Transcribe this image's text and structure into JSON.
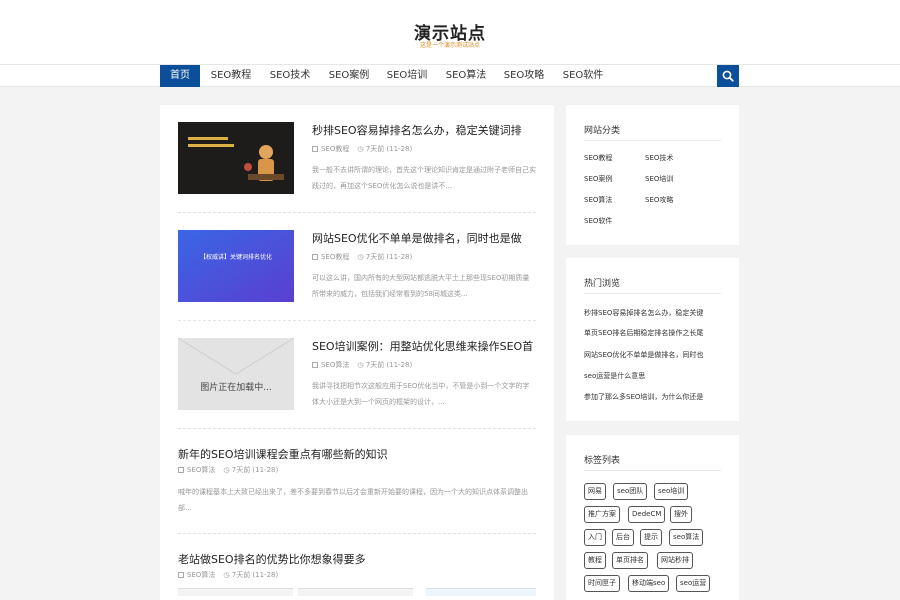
{
  "site": {
    "title": "演示站点",
    "tagline": "这是一个演示测试站点"
  },
  "nav": {
    "items": [
      "首页",
      "SEO教程",
      "SEO技术",
      "SEO案例",
      "SEO培训",
      "SEO算法",
      "SEO攻略",
      "SEO软件"
    ],
    "active_index": 0
  },
  "colors": {
    "primary": "#0b4f9b",
    "tagline": "#e08a1e"
  },
  "posts": [
    {
      "title": "秒排SEO容易掉排名怎么办，稳定关键词排",
      "category": "SEO教程",
      "time": "7天前 (11-28)",
      "excerpt": "我一般不去讲所谓的理论，首先这个理论知识肯定是通过附子老师自己实践过的，再加这个SEO优化怎么说也是讲不..."
    },
    {
      "title": "网站SEO优化不单单是做排名，同时也是做",
      "category": "SEO教程",
      "time": "7天前 (11-28)",
      "excerpt": "可以这么讲，国内所有的大型网站都逃脱大平土上那些现SEO初期质量所带来的威力，包括我们经常看到的58同城这类...",
      "thumb_text": "【权威讲】关键词排名优化"
    },
    {
      "title": "SEO培训案例：用整站优化思维来操作SEO首",
      "category": "SEO算法",
      "time": "7天前 (11-28)",
      "excerpt": "我讲寻找把相节次这般应用于SEO优化当中，不管是小到一个文字的字体大小还是大到一个网页的框架的设计，...",
      "thumb_text": "图片正在加载中..."
    },
    {
      "title": "新年的SEO培训课程会重点有哪些新的知识",
      "category": "SEO算法",
      "time": "7天前 (11-28)",
      "excerpt": "喊年的课程基本上大致已经出来了，差不多要到春节以后才会重新开始要的课程，因为一个大的知识点体系调整出部..."
    },
    {
      "title": "老站做SEO排名的优势比你想象得要多",
      "category": "SEO算法",
      "time": "7天前 (11-28)"
    }
  ],
  "sidebar": {
    "categories": {
      "title": "网站分类",
      "items": [
        "SEO教程",
        "SEO技术",
        "SEO案例",
        "SEO培训",
        "SEO算法",
        "SEO攻略",
        "SEO软件"
      ]
    },
    "hot": {
      "title": "热门浏览",
      "items": [
        "秒排SEO容易掉排名怎么办，稳定关键",
        "单页SEO排名后期稳定排名操作之长尾",
        "网站SEO优化不单单是做排名，同时也",
        "seo运营是什么意思",
        "参加了那么多SEO培训，为什么你还是"
      ]
    },
    "tags": {
      "title": "标签列表",
      "items": [
        "网易",
        "seo团队",
        "seo培训",
        "推广方案",
        "DedeCM",
        "搜外",
        "入门",
        "后台",
        "提示",
        "seo算法",
        "教程",
        "单页排名",
        "网站秒排",
        "时间匣子",
        "移动端seo",
        "seo运营"
      ]
    }
  }
}
